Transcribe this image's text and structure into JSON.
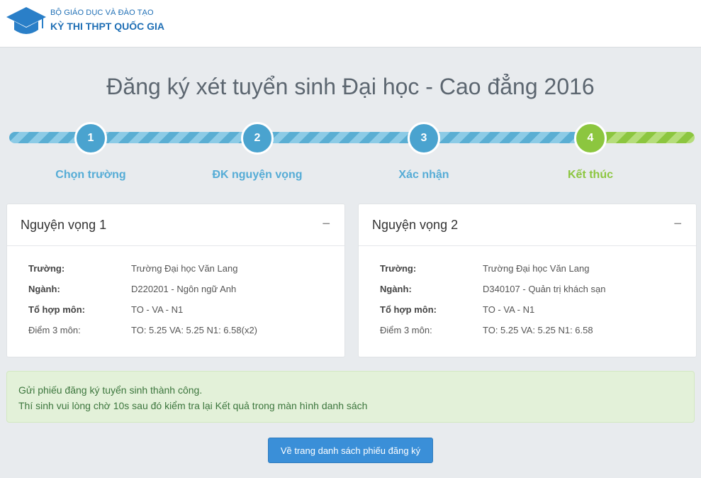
{
  "header": {
    "org_name": "BỘ GIÁO DỤC VÀ ĐÀO TẠO",
    "exam_name": "KỲ THI THPT QUỐC GIA",
    "logo_icon": "graduation-cap-icon"
  },
  "page_title": "Đăng ký xét tuyển sinh Đại học - Cao đẳng 2016",
  "progress": {
    "colors": {
      "active": "#4aa3cf",
      "complete": "#8cc63f"
    },
    "steps": [
      {
        "number": "1",
        "label": "Chọn trường"
      },
      {
        "number": "2",
        "label": "ĐK nguyện vọng"
      },
      {
        "number": "3",
        "label": "Xác nhận"
      },
      {
        "number": "4",
        "label": "Kết thúc"
      }
    ]
  },
  "panels": [
    {
      "title": "Nguyện vọng 1",
      "collapse_label": "−",
      "rows": [
        {
          "label": "Trường:",
          "value": "Trường Đại học Văn Lang"
        },
        {
          "label": "Ngành:",
          "value": "D220201 - Ngôn ngữ Anh"
        },
        {
          "label": "Tổ hợp môn:",
          "value": "TO - VA - N1"
        },
        {
          "label": "Điểm 3 môn:",
          "value": "TO: 5.25 VA: 5.25 N1: 6.58(x2)"
        }
      ]
    },
    {
      "title": "Nguyện vọng 2",
      "collapse_label": "−",
      "rows": [
        {
          "label": "Trường:",
          "value": "Trường Đại học Văn Lang"
        },
        {
          "label": "Ngành:",
          "value": "D340107 - Quản trị khách sạn"
        },
        {
          "label": "Tổ hợp môn:",
          "value": "TO - VA - N1"
        },
        {
          "label": "Điểm 3 môn:",
          "value": "TO: 5.25 VA: 5.25 N1: 6.58"
        }
      ]
    }
  ],
  "alert": {
    "line1": "Gửi phiếu đăng ký tuyển sinh thành công.",
    "line2": "Thí sinh vui lòng chờ 10s sau đó kiểm tra lại Kết quả trong màn hình danh sách"
  },
  "back_button_label": "Về trang danh sách phiếu đăng ký"
}
